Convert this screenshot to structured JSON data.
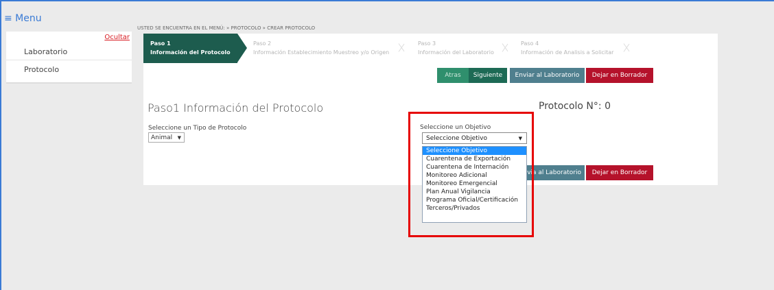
{
  "menu": {
    "label": "≡ Menu"
  },
  "sidebar": {
    "hide_label": "Ocultar",
    "items": [
      {
        "label": "Laboratorio"
      },
      {
        "label": "Protocolo"
      }
    ]
  },
  "breadcrumb": "USTED SE ENCUENTRA EN EL MENÚ: » PROTOCOLO » CREAR PROTOCOLO",
  "steps": [
    {
      "num": "Paso 1",
      "title": "Información del Protocolo",
      "active": true
    },
    {
      "num": "Paso 2",
      "title": "Información Establecimiento Muestreo y/o Origen",
      "active": false
    },
    {
      "num": "Paso 3",
      "title": "Información del Laboratorio",
      "active": false
    },
    {
      "num": "Paso 4",
      "title": "Información de Analisis a Solicitar",
      "active": false
    }
  ],
  "buttons": {
    "back": "Atras",
    "next": "Siguiente",
    "send": "Enviar al Laboratorio",
    "send_partial": "via al Laboratorio",
    "draft": "Dejar en Borrador"
  },
  "form": {
    "title": "Paso1 Información del Protocolo",
    "protocol_number": "Protocolo N°: 0",
    "tipo_label": "Seleccione un Tipo de Protocolo",
    "tipo_value": "Animal",
    "objetivo_label": "Seleccione un Objetivo",
    "objetivo_value": "Seleccione Objetivo",
    "objetivo_options": [
      "Seleccione Objetivo",
      "Cuarentena de Exportación",
      "Cuarentena de Internación",
      "Monitoreo Adicional",
      "Monitoreo Emergencial",
      "Plan Anual Vigilancia",
      "Programa Oficial/Certificación",
      "Terceros/Privados"
    ]
  },
  "colors": {
    "active_step": "#1d5c4e",
    "next_button": "#1d6a55",
    "send_button": "#4f7f8e",
    "draft_button": "#b5122b",
    "highlight": "#e60000",
    "selected_option": "#1e90ff"
  }
}
